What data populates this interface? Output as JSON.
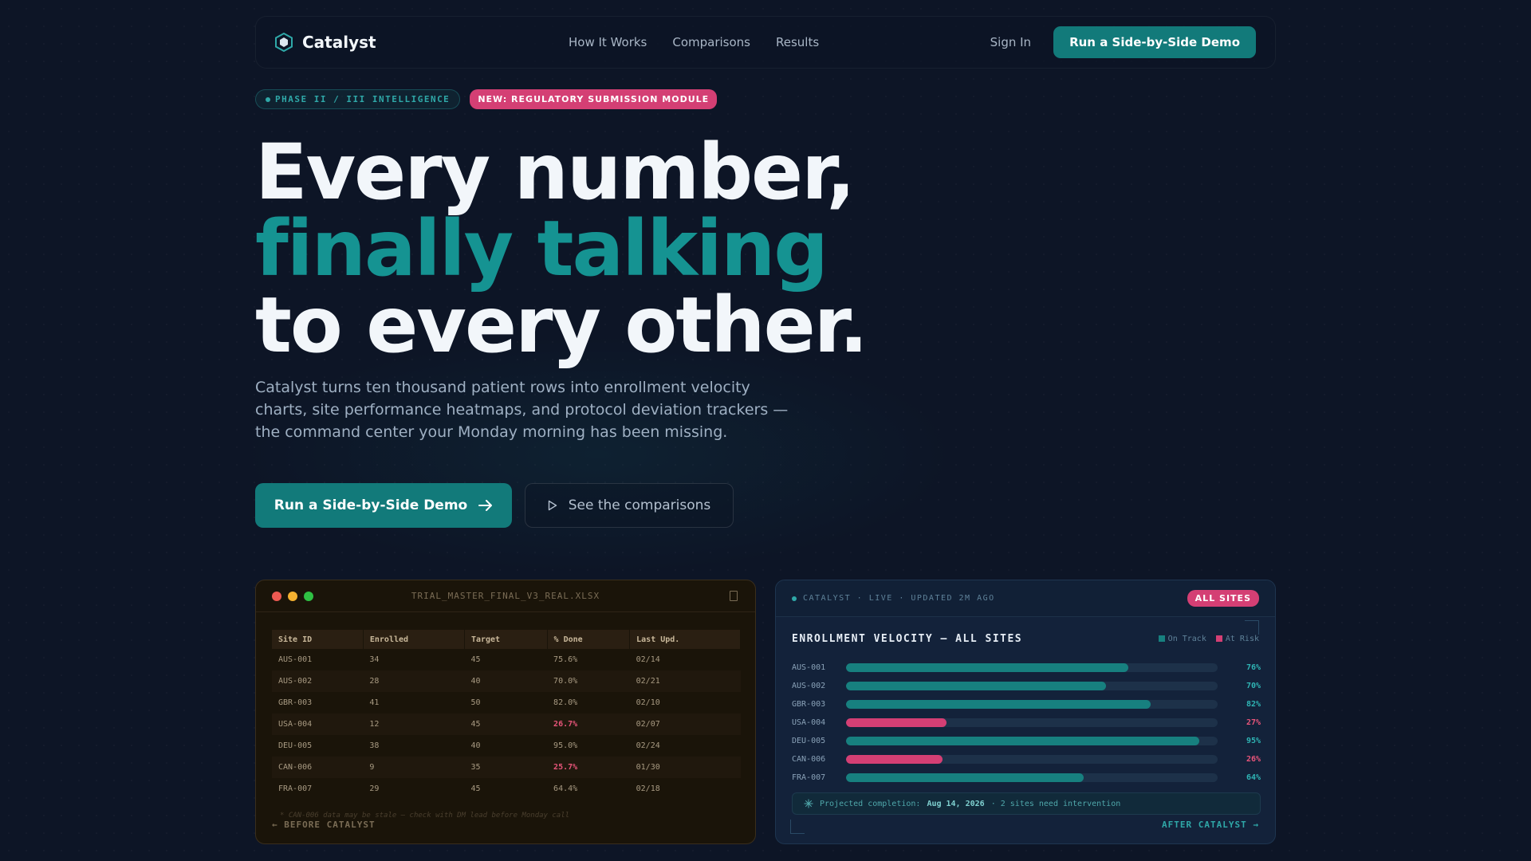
{
  "brand": {
    "name": "Catalyst"
  },
  "nav": {
    "links": [
      "How It Works",
      "Comparisons",
      "Results"
    ],
    "sign_in": "Sign In",
    "cta": "Run a Side-by-Side Demo"
  },
  "badges": {
    "phase": "PHASE II / III INTELLIGENCE",
    "new": "NEW: REGULATORY SUBMISSION MODULE"
  },
  "hero": {
    "line1": "Every number,",
    "line2": "finally talking",
    "line3": "to every other.",
    "description": "Catalyst turns ten thousand patient rows into enrollment velocity charts, site performance heatmaps, and protocol deviation trackers — the command center your Monday morning has been missing.",
    "cta_primary": "Run a Side-by-Side Demo",
    "cta_secondary": "See the comparisons"
  },
  "before_panel": {
    "filename": "TRIAL_MASTER_FINAL_V3_REAL.XLSX",
    "columns": [
      "Site ID",
      "Enrolled",
      "Target",
      "% Done",
      "Last Upd."
    ],
    "rows": [
      [
        "AUS-001",
        "34",
        "45",
        "75.6%",
        "02/14"
      ],
      [
        "AUS-002",
        "28",
        "40",
        "70.0%",
        "02/21"
      ],
      [
        "GBR-003",
        "41",
        "50",
        "82.0%",
        "02/10"
      ],
      [
        "USA-004",
        "12",
        "45",
        "26.7%",
        "02/07"
      ],
      [
        "DEU-005",
        "38",
        "40",
        "95.0%",
        "02/24"
      ],
      [
        "CAN-006",
        "9",
        "35",
        "25.7%",
        "01/30"
      ],
      [
        "FRA-007",
        "29",
        "45",
        "64.4%",
        "02/18"
      ]
    ],
    "flagged_rows": [
      3,
      5
    ],
    "footnote": "* CAN-006 data may be stale — check with DM lead before Monday call",
    "label": "← BEFORE CATALYST"
  },
  "after_panel": {
    "status": "CATALYST · LIVE · UPDATED 2M AGO",
    "filter": "ALL SITES",
    "title": "ENROLLMENT VELOCITY — ALL SITES",
    "legend": [
      "On Track",
      "At Risk"
    ],
    "projection_prefix": "Projected completion:",
    "projection_date": "Aug 14, 2026",
    "projection_suffix": "· 2 sites need intervention",
    "label": "AFTER CATALYST →"
  },
  "colors": {
    "on_track": "#17807f",
    "at_risk": "#d43f74",
    "pct_on_track": "#2fb4b4",
    "pct_at_risk": "#e8557a"
  },
  "chart_data": {
    "type": "bar",
    "orientation": "horizontal",
    "title": "ENROLLMENT VELOCITY — ALL SITES",
    "categories": [
      "AUS-001",
      "AUS-002",
      "GBR-003",
      "USA-004",
      "DEU-005",
      "CAN-006",
      "FRA-007"
    ],
    "values": [
      76,
      70,
      82,
      27,
      95,
      26,
      64
    ],
    "status": [
      "On Track",
      "On Track",
      "On Track",
      "At Risk",
      "On Track",
      "At Risk",
      "On Track"
    ],
    "value_labels": [
      "76%",
      "70%",
      "82%",
      "27%",
      "95%",
      "26%",
      "64%"
    ],
    "xlim": [
      0,
      100
    ],
    "legend": "top-right",
    "grid": false
  }
}
